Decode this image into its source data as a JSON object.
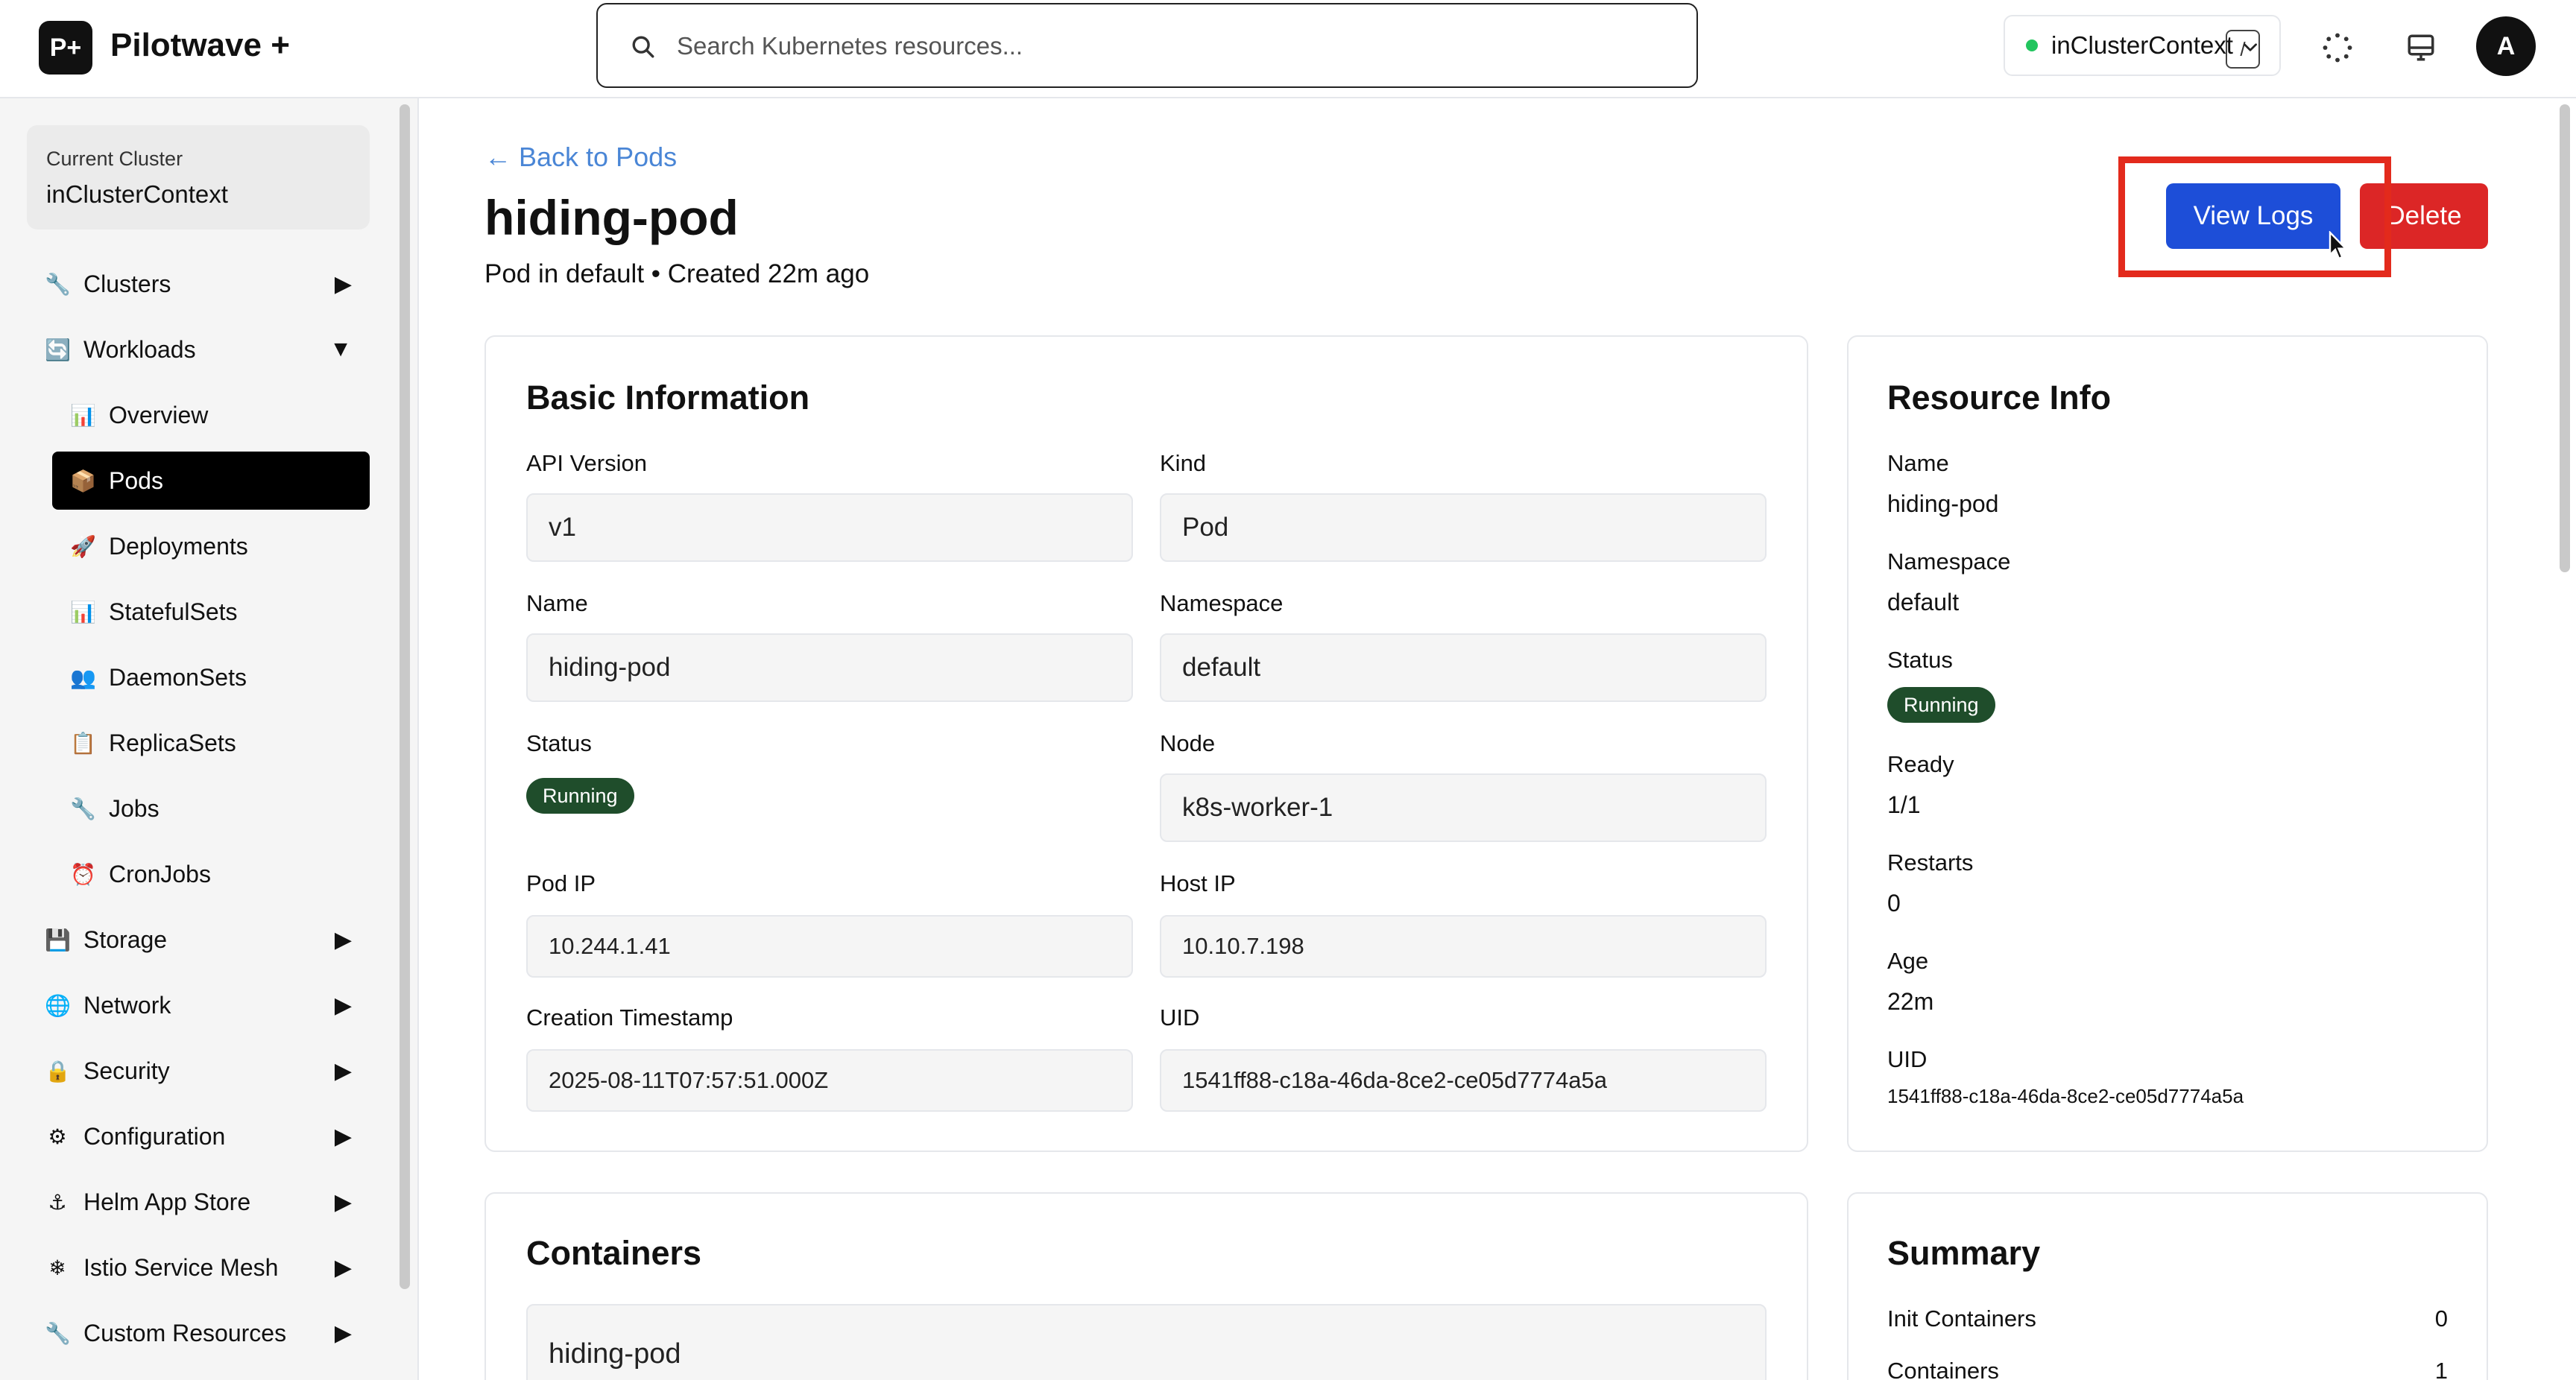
{
  "app": {
    "logo": "P+",
    "title": "Pilotwave +"
  },
  "search": {
    "placeholder": "Search Kubernetes resources...",
    "shortcut": "/"
  },
  "context_selector": {
    "value": "inClusterContext",
    "status_color": "#22c55e"
  },
  "header_icons": [
    "loading-spinner-icon",
    "monitor-icon"
  ],
  "user": {
    "avatar_initial": "A"
  },
  "sidebar": {
    "current_cluster_label": "Current Cluster",
    "current_cluster_name": "inClusterContext",
    "items": [
      {
        "icon": "🔧",
        "label": "Clusters",
        "arrow": "▶"
      },
      {
        "icon": "🔄",
        "label": "Workloads",
        "arrow": "▼"
      },
      {
        "icon": "💾",
        "label": "Storage",
        "arrow": "▶"
      },
      {
        "icon": "🌐",
        "label": "Network",
        "arrow": "▶"
      },
      {
        "icon": "🔒",
        "label": "Security",
        "arrow": "▶"
      },
      {
        "icon": "⚙",
        "label": "Configuration",
        "arrow": "▶"
      },
      {
        "icon": "⚓",
        "label": "Helm App Store",
        "arrow": "▶"
      },
      {
        "icon": "❄",
        "label": "Istio Service Mesh",
        "arrow": "▶"
      },
      {
        "icon": "🔧",
        "label": "Custom Resources",
        "arrow": "▶"
      }
    ],
    "workloads_sub": [
      {
        "icon": "📊",
        "label": "Overview"
      },
      {
        "icon": "📦",
        "label": "Pods",
        "active": true
      },
      {
        "icon": "🚀",
        "label": "Deployments"
      },
      {
        "icon": "📊",
        "label": "StatefulSets"
      },
      {
        "icon": "👥",
        "label": "DaemonSets"
      },
      {
        "icon": "📋",
        "label": "ReplicaSets"
      },
      {
        "icon": "🔧",
        "label": "Jobs"
      },
      {
        "icon": "⏰",
        "label": "CronJobs"
      }
    ]
  },
  "page": {
    "back_link": "← Back to Pods",
    "title": "hiding-pod",
    "subtitle": "Pod in default • Created 22m ago",
    "view_logs_label": "View Logs",
    "delete_label": "Delete"
  },
  "basic_info": {
    "title": "Basic Information",
    "api_version_label": "API Version",
    "api_version": "v1",
    "kind_label": "Kind",
    "kind": "Pod",
    "name_label": "Name",
    "name": "hiding-pod",
    "namespace_label": "Namespace",
    "namespace": "default",
    "status_label": "Status",
    "status": "Running",
    "node_label": "Node",
    "node": "k8s-worker-1",
    "pod_ip_label": "Pod IP",
    "pod_ip": "10.244.1.41",
    "host_ip_label": "Host IP",
    "host_ip": "10.10.7.198",
    "creation_label": "Creation Timestamp",
    "creation": "2025-08-11T07:57:51.000Z",
    "uid_label": "UID",
    "uid": "1541ff88-c18a-46da-8ce2-ce05d7774a5a"
  },
  "resource_info": {
    "title": "Resource Info",
    "name_label": "Name",
    "name": "hiding-pod",
    "namespace_label": "Namespace",
    "namespace": "default",
    "status_label": "Status",
    "status": "Running",
    "ready_label": "Ready",
    "ready": "1/1",
    "restarts_label": "Restarts",
    "restarts": "0",
    "age_label": "Age",
    "age": "22m",
    "uid_label": "UID",
    "uid": "1541ff88-c18a-46da-8ce2-ce05d7774a5a"
  },
  "containers": {
    "title": "Containers",
    "first_container": "hiding-pod"
  },
  "summary": {
    "title": "Summary",
    "init_containers_label": "Init Containers",
    "init_containers": "0",
    "containers_label": "Containers",
    "containers": "1"
  },
  "colors": {
    "primary_button": "#1d4ed8",
    "danger_button": "#dc2626",
    "running_badge": "#1f4d2b",
    "link": "#4a86d6",
    "highlight_box": "#e32a1c"
  }
}
